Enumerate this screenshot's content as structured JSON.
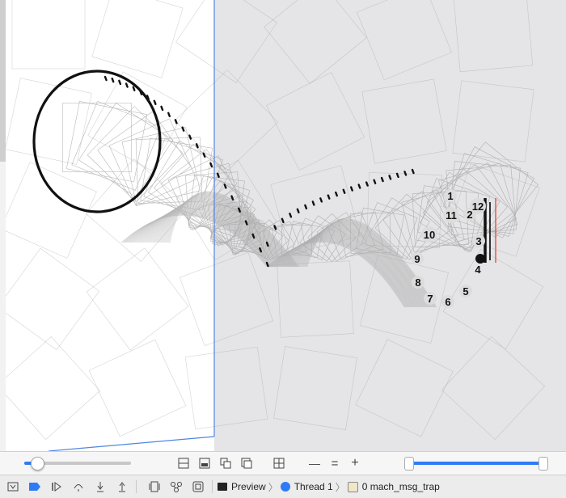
{
  "preview": {
    "clock_numbers": [
      "1",
      "2",
      "3",
      "4",
      "5",
      "6",
      "7",
      "8",
      "9",
      "10",
      "11",
      "12"
    ]
  },
  "controls": {
    "minus": "—",
    "equals": "=",
    "plus": "+"
  },
  "debug_bar": {
    "breadcrumbs": [
      "Preview",
      "Thread 1",
      "0 mach_msg_trap"
    ]
  },
  "colors": {
    "accent": "#2f7bf5",
    "canvas_gray": "#e5e5e7",
    "pointer_red": "#e8503c"
  },
  "icons": [
    "step-icon",
    "breakpoint-icon",
    "continue-icon",
    "step-over-icon",
    "step-in-icon",
    "step-out-icon",
    "view-debugger-icon",
    "memory-graph-icon",
    "environment-icon"
  ]
}
